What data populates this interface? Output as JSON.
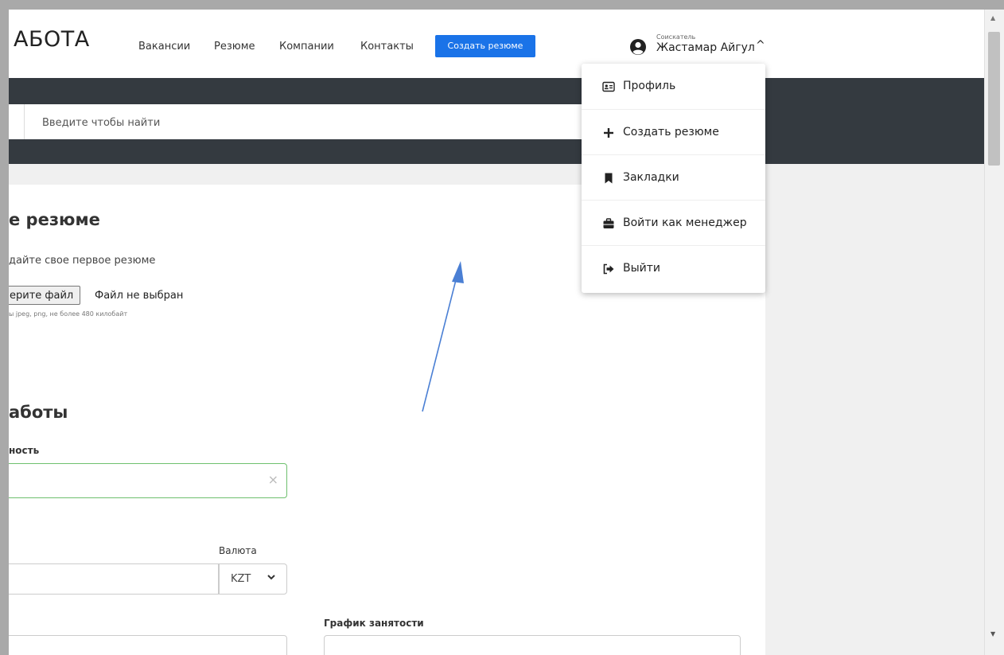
{
  "header": {
    "logo_text": "АБОТА",
    "nav": [
      {
        "label": "Вакансии"
      },
      {
        "label": "Резюме"
      },
      {
        "label": "Компании"
      },
      {
        "label": "Контакты"
      }
    ],
    "create_button": "Создать резюме",
    "user": {
      "role": "Соискатель",
      "name": "Жастамар Айгул",
      "caret": "^"
    }
  },
  "search": {
    "placeholder": "Введите чтобы найти",
    "value": ""
  },
  "dropdown": {
    "items": [
      {
        "label": "Профиль",
        "icon": "id-card-icon"
      },
      {
        "label": "Создать резюме",
        "icon": "plus-icon"
      },
      {
        "label": "Закладки",
        "icon": "bookmark-icon"
      },
      {
        "label": "Войти как менеджер",
        "icon": "briefcase-icon"
      },
      {
        "label": "Выйти",
        "icon": "sign-out-icon"
      }
    ]
  },
  "form": {
    "title": "е резюме",
    "subtitle": "дайте свое первое резюме",
    "file_button": "ерите файл",
    "file_status": "Файл не выбран",
    "file_hint": "ы jpeg, png, не более 480 килобайт",
    "section_title": "аботы",
    "position_label": "ность",
    "position_clear": "×",
    "currency_label": "Валюта",
    "currency_value": "KZT",
    "schedule_label": "График занятости"
  },
  "scrollbar": {
    "up": "▲",
    "down": "▼"
  },
  "colors": {
    "accent": "#1a73e8",
    "dark_band": "#343a40",
    "valid_border": "#6ec06e",
    "arrow": "#4a7fd4"
  }
}
